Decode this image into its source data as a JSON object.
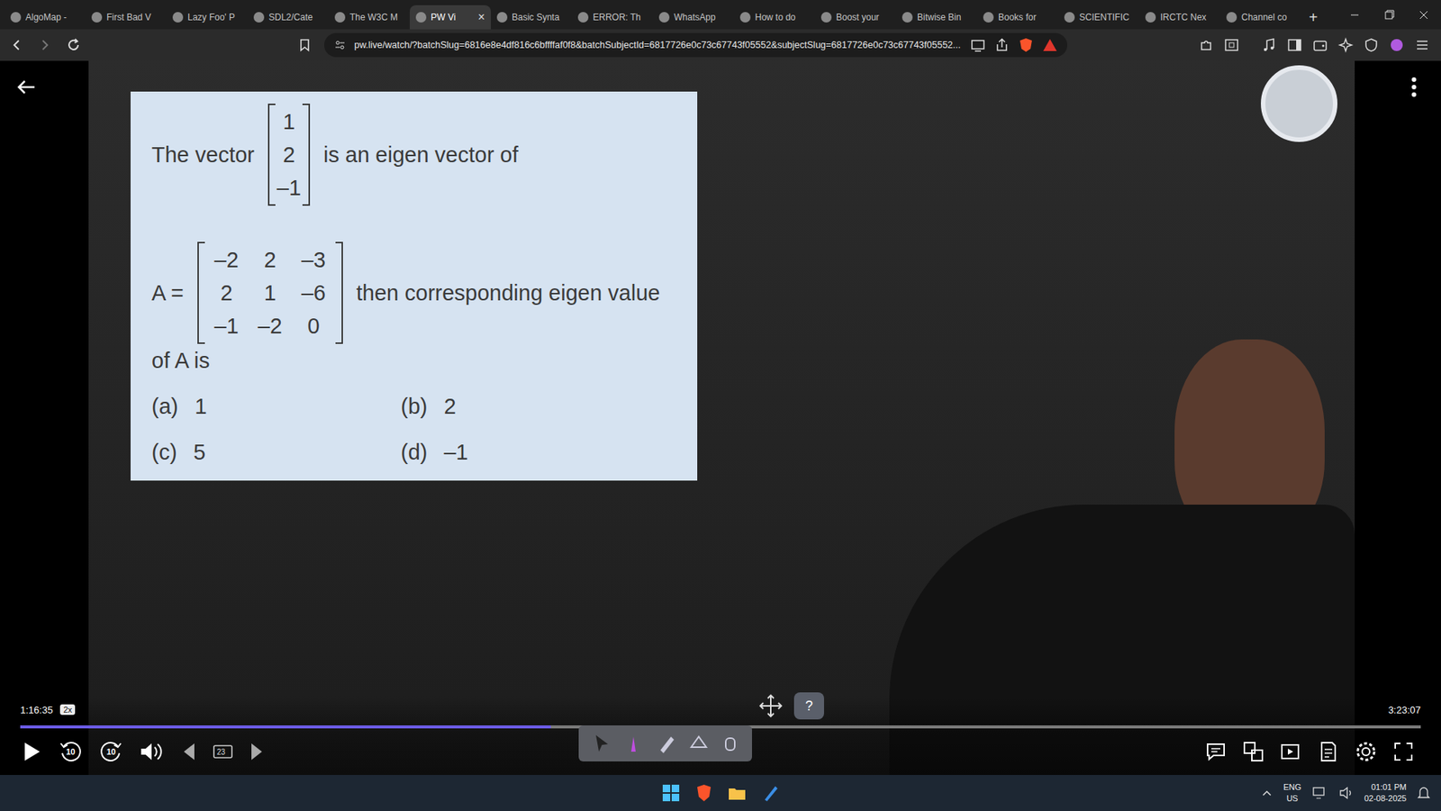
{
  "browser": {
    "tabs": [
      {
        "label": "AlgoMap -",
        "selected": false
      },
      {
        "label": "First Bad V",
        "selected": false
      },
      {
        "label": "Lazy Foo' P",
        "selected": false
      },
      {
        "label": "SDL2/Cate",
        "selected": false
      },
      {
        "label": "The W3C M",
        "selected": false
      },
      {
        "label": "PW Vi",
        "selected": true
      },
      {
        "label": "Basic Synta",
        "selected": false
      },
      {
        "label": "ERROR: Th",
        "selected": false
      },
      {
        "label": "WhatsApp",
        "selected": false
      },
      {
        "label": "How to do",
        "selected": false
      },
      {
        "label": "Boost your",
        "selected": false
      },
      {
        "label": "Bitwise Bin",
        "selected": false
      },
      {
        "label": "Books for",
        "selected": false
      },
      {
        "label": "SCIENTIFIC",
        "selected": false
      },
      {
        "label": "IRCTC Nex",
        "selected": false
      },
      {
        "label": "Channel co",
        "selected": false
      }
    ],
    "tab_close": "×",
    "new_tab": "+",
    "url": "pw.live/watch/?batchSlug=6816e8e4df816c6bffffaf0f8&batchSubjectId=6817726e0c73c67743f05552&subjectSlug=6817726e0c73c67743f05552..."
  },
  "slide": {
    "intro": "The vector",
    "vector": [
      "1",
      "2",
      "–1"
    ],
    "intro_end": "is an eigen vector of",
    "matrix_label": "A =",
    "matrix": [
      [
        "–2",
        "2",
        "–3"
      ],
      [
        "2",
        "1",
        "–6"
      ],
      [
        "–1",
        "–2",
        "0"
      ]
    ],
    "after_matrix": "then corresponding eigen value",
    "tail": "of A is",
    "options": [
      {
        "key": "(a)",
        "value": "1"
      },
      {
        "key": "(b)",
        "value": "2"
      },
      {
        "key": "(c)",
        "value": "5"
      },
      {
        "key": "(d)",
        "value": "–1"
      }
    ]
  },
  "player": {
    "current_time": "1:16:35",
    "speed": "2x",
    "duration": "3:23:07",
    "progress": {
      "level": 0.379
    },
    "rewind_label": "10",
    "forward_label": "10",
    "badge": "23",
    "help": "?"
  },
  "taskbar": {
    "language": "ENG",
    "region": "US",
    "time": "01:01 PM",
    "date": "02-08-2025"
  }
}
